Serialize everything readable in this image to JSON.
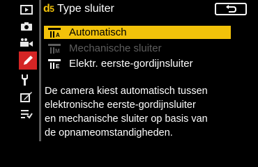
{
  "header": {
    "code_letter": "d",
    "code_number": "5",
    "title": "Type sluiter"
  },
  "sidebar": {
    "items": [
      {
        "icon": "playback-icon"
      },
      {
        "icon": "camera-icon"
      },
      {
        "icon": "movie-icon"
      },
      {
        "icon": "pencil-icon",
        "active": true
      },
      {
        "icon": "wrench-icon"
      },
      {
        "icon": "retouch-icon"
      },
      {
        "icon": "my-menu-icon"
      }
    ]
  },
  "options": [
    {
      "label": "Automatisch",
      "icon": "auto-shutter-icon",
      "state": "selected"
    },
    {
      "label": "Mechanische sluiter",
      "icon": "mechanical-shutter-icon",
      "state": "disabled"
    },
    {
      "label": "Elektr. eerste-gordijnsluiter",
      "icon": "efc-shutter-icon",
      "state": "normal"
    }
  ],
  "description": {
    "line1": "De camera kiest automatisch tussen",
    "line2": "elektronische eerste-gordijnsluiter",
    "line3": "en mechanische sluiter op basis van",
    "line4": "de opnameomstandigheden."
  },
  "colors": {
    "accent": "#f2c20a",
    "active_tab": "#d42525",
    "disabled_text": "#5d5d5d"
  }
}
